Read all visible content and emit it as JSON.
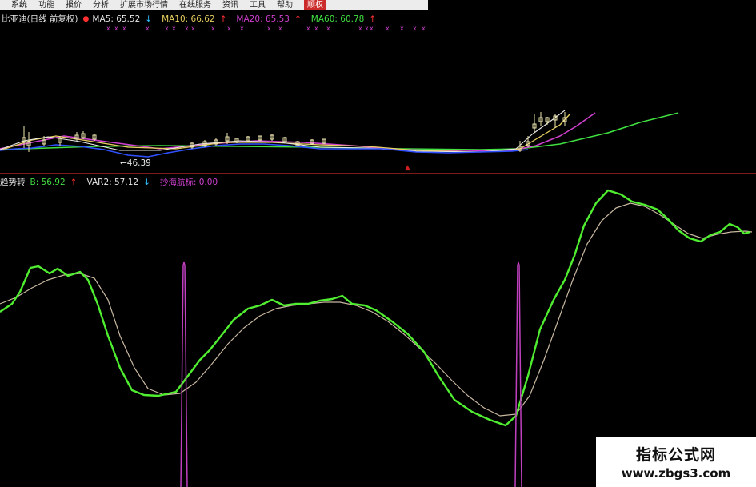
{
  "menu": {
    "items": [
      "系统",
      "功能",
      "报价",
      "分析",
      "扩展市场行情",
      "在线服务",
      "资讯",
      "工具",
      "帮助"
    ],
    "active_item": "顺权"
  },
  "upper_panel": {
    "stock_name": "比亚迪(日线 前复权)",
    "ma5": {
      "label": "MA5: 65.52",
      "arrow": "↓",
      "color": "#e8e8e8"
    },
    "ma10": {
      "label": "MA10: 66.62",
      "arrow": "↑",
      "color": "#e8d060"
    },
    "ma20": {
      "label": "MA20: 65.53",
      "arrow": "↑",
      "color": "#d040d0"
    },
    "ma60": {
      "label": "MA60: 60.78",
      "arrow": "↑",
      "color": "#40e040"
    },
    "low_price_label": "←46.39",
    "x_marker": "x"
  },
  "lower_panel": {
    "indicator_name": "趋势转",
    "b_value": {
      "label": "B: 56.92",
      "arrow": "↑",
      "color": "#40e040"
    },
    "var2_value": {
      "label": "VAR2: 57.12",
      "arrow": "↓",
      "color": "#e8e8e8"
    },
    "bottom_value": {
      "label": "抄海航标: 0.00",
      "color": "#d040d0"
    }
  },
  "watermark": {
    "line1": "指标公式网",
    "line2": "www.zbgs3.com"
  },
  "colors": {
    "background": "#000000",
    "ma5": "#e8e8e8",
    "ma10": "#e8d060",
    "ma20": "#d040d0",
    "ma60": "#40e040",
    "price_line": "#3050ff",
    "b_line": "#50ee30",
    "var2_line": "#c8b8a0",
    "signal": "#c040c0",
    "arrow_up": "#ff3030",
    "arrow_down": "#30c0ff"
  }
}
